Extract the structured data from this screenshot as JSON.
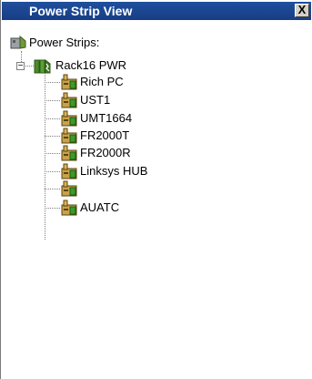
{
  "panel": {
    "title": "Power Strip View",
    "close_glyph": "X"
  },
  "tree": {
    "root_label": "Power Strips:",
    "rack_label": "Rack16 PWR",
    "expander_glyph": "−",
    "outlets": [
      {
        "label": "Rich PC"
      },
      {
        "label": "UST1"
      },
      {
        "label": "UMT1664"
      },
      {
        "label": "FR2000T"
      },
      {
        "label": "FR2000R"
      },
      {
        "label": "Linksys HUB"
      },
      {
        "label": ""
      },
      {
        "label": "AUATC"
      }
    ]
  },
  "icons": {
    "root": "power-strips-icon",
    "rack": "power-strip-icon",
    "outlet": "outlet-plug-icon"
  }
}
